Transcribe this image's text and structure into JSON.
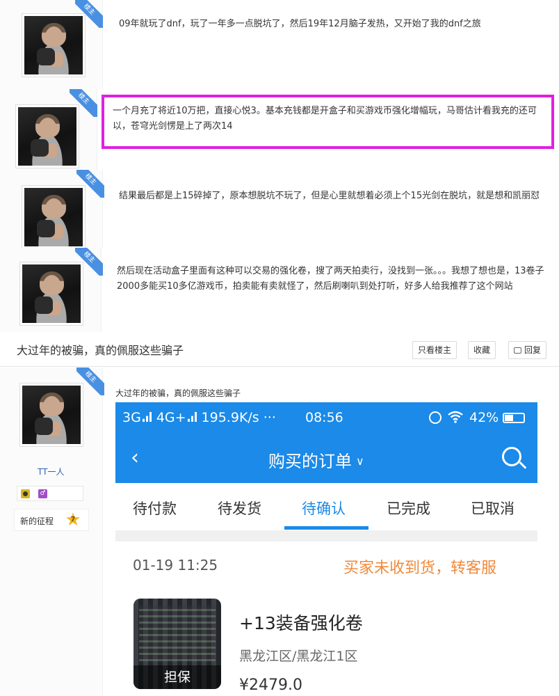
{
  "posts": [
    {
      "badge": "楼主",
      "text": "09年就玩了dnf，玩了一年多一点脱坑了，然后19年12月脑子发热，又开始了我的dnf之旅"
    },
    {
      "badge": "楼主",
      "text": "一个月充了将近10万把，直接心悦3。基本充钱都是开盒子和买游戏币强化增幅玩，马哥估计看我充的还可以，苍穹光剑愣是上了两次14"
    },
    {
      "badge": "楼主",
      "text": "结果最后都是上15碎掉了，原本想脱坑不玩了，但是心里就想着必须上个15光剑在脱坑，就是想和凯丽怼"
    },
    {
      "badge": "楼主",
      "text": "然后现在活动盒子里面有这种可以交易的强化卷，搜了两天拍卖行，没找到一张。。。我想了想也是，13卷子2000多能买10多亿游戏币，拍卖能有卖就怪了，然后刷喇叭到处打听，好多人给我推荐了这个网站"
    }
  ],
  "thread": {
    "title": "大过年的被骗，真的佩服这些骗子",
    "only_op_label": "只看楼主",
    "favorite_label": "收藏",
    "reply_label": "回复"
  },
  "last_post": {
    "badge": "楼主",
    "username": "TT一人",
    "level_name": "新的征程",
    "level": "7",
    "caption": "大过年的被骗，真的佩服这些骗子"
  },
  "phone": {
    "status_network": "3G",
    "status_network2": "4G+",
    "status_speed": "195.9K/s ···",
    "status_time": "08:56",
    "status_battery": "42%",
    "nav_back": "‹",
    "nav_title": "购买的订单",
    "tabs": [
      "待付款",
      "待发货",
      "待确认",
      "已完成",
      "已取消"
    ],
    "active_tab": 2,
    "order_time": "01-19 11:25",
    "order_status": "买家未收到货，转客服",
    "item_badge": "担保",
    "item_title": "+13装备强化卷",
    "item_server": "黑龙江区/黑龙江1区",
    "item_price": "¥2479.0"
  },
  "colors": {
    "accent_blue": "#1b8ae8",
    "highlight_magenta": "#e020e0",
    "status_orange": "#ef8a3c",
    "badge_blue": "#4a90e2"
  }
}
